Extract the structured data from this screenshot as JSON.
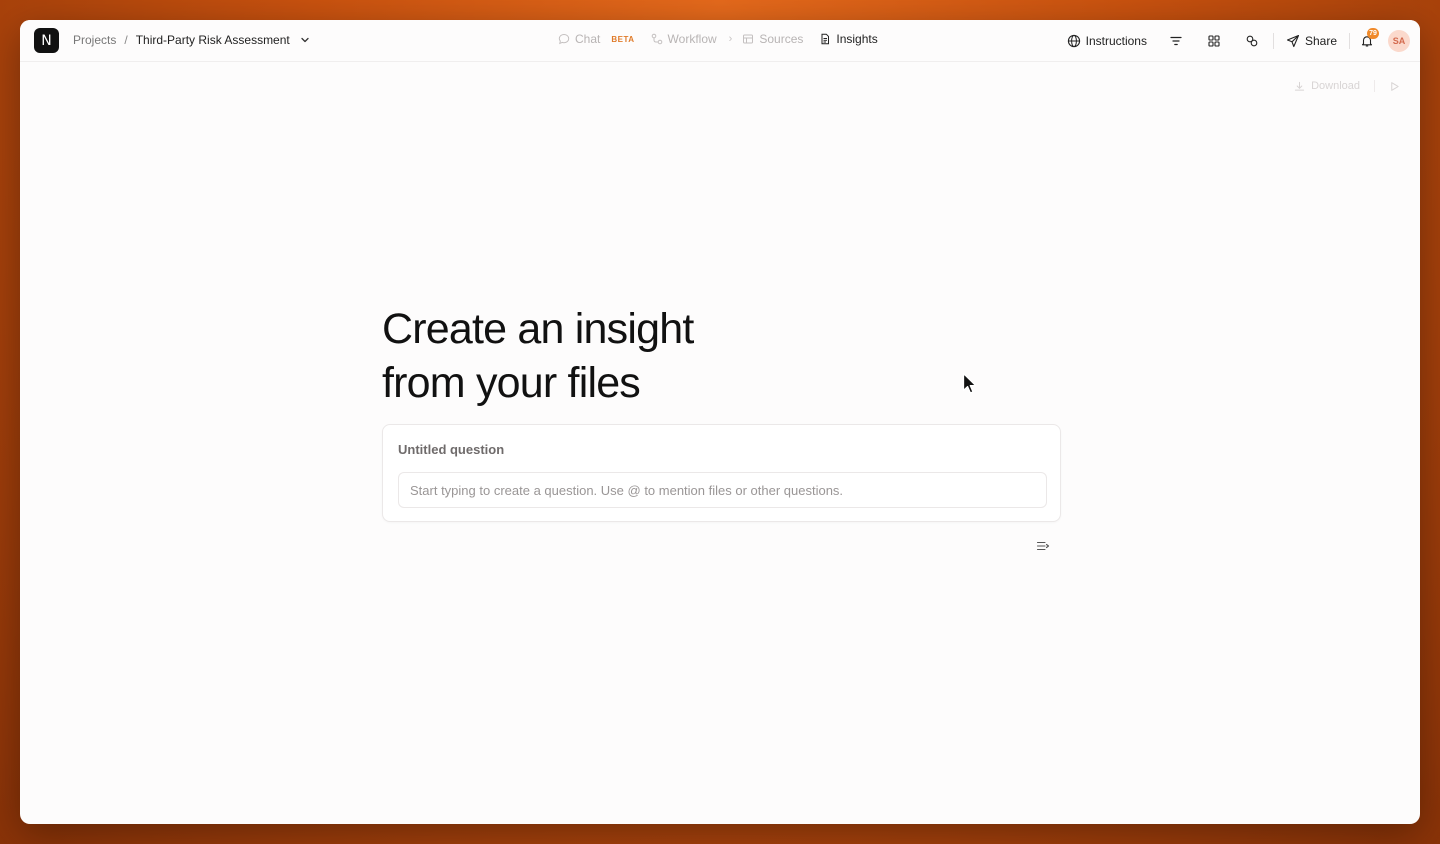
{
  "app": {
    "logo_letter": "N"
  },
  "breadcrumb": {
    "root": "Projects",
    "separator": "/",
    "project": "Third-Party Risk Assessment"
  },
  "nav": {
    "chat": {
      "label": "Chat",
      "badge": "BETA"
    },
    "workflow": {
      "label": "Workflow"
    },
    "arrow": "›",
    "sources": {
      "label": "Sources"
    },
    "insights": {
      "label": "Insights"
    }
  },
  "toolbar": {
    "instructions_label": "Instructions",
    "share_label": "Share",
    "notification_count": "79",
    "avatar_initials": "SA"
  },
  "sub_toolbar": {
    "download_label": "Download"
  },
  "hero": {
    "line1": "Create an insight",
    "line2": "from your files"
  },
  "question": {
    "title": "Untitled question",
    "input_value": "",
    "input_placeholder": "Start typing to create a question. Use @ to mention files or other questions."
  },
  "icons": {
    "dropdown": "chevron-down-icon",
    "chat": "chat-bubble-icon",
    "workflow": "workflow-icon",
    "sources": "table-icon",
    "insights": "document-icon",
    "instructions": "globe-icon",
    "filter": "filter-icon",
    "grid": "grid-icon",
    "link": "link-icon",
    "share": "send-icon",
    "bell": "bell-icon",
    "download": "download-icon",
    "run": "play-icon",
    "card_menu": "list-arrow-icon"
  },
  "colors": {
    "background_orange": "#e66a1c",
    "badge_orange": "#f08a2b",
    "beta_orange": "#e07b2a",
    "avatar_bg": "#fbd9cc"
  }
}
